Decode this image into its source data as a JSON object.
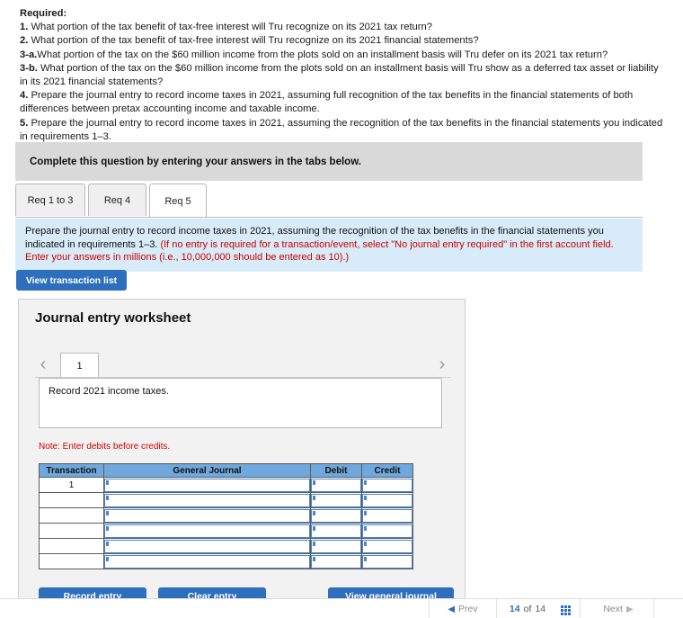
{
  "required": {
    "title": "Required:",
    "items": [
      {
        "num": "1.",
        "text": " What portion of the tax benefit of tax-free interest will Tru recognize on its 2021 tax return?"
      },
      {
        "num": "2.",
        "text": " What portion of the tax benefit of tax-free interest will Tru recognize on its 2021 financial statements?"
      },
      {
        "num": "3-a.",
        "text": "What portion of the tax on the $60 million income from the plots sold on an installment basis will Tru defer on its 2021 tax return?"
      },
      {
        "num": "3-b.",
        "text": " What portion of the tax on the $60 million income from the plots sold on an installment basis will Tru show as a deferred tax asset or liability in its 2021 financial statements?"
      },
      {
        "num": "4.",
        "text": " Prepare the journal entry to record income taxes in 2021, assuming full recognition of the tax benefits in the financial statements of both differences between pretax accounting income and taxable income."
      },
      {
        "num": "5.",
        "text": " Prepare the journal entry to record income taxes in 2021, assuming the recognition of the tax benefits in the financial statements you indicated in requirements 1–3."
      }
    ]
  },
  "banner": {
    "text": "Complete this question by entering your answers in the tabs below."
  },
  "tabs": [
    {
      "label": "Req 1 to 3",
      "active": false
    },
    {
      "label": "Req 4",
      "active": false
    },
    {
      "label": "Req 5",
      "active": true
    }
  ],
  "instruction": {
    "black": "Prepare the journal entry to record income taxes in 2021, assuming the recognition of the tax benefits in the financial statements you indicated in requirements 1–3. ",
    "red": "(If no entry is required for a transaction/event, select \"No journal entry required\" in the first account field. Enter your answers in millions (i.e., 10,000,000 should be entered as 10).)"
  },
  "view_transaction_button": {
    "label": "View transaction list"
  },
  "worksheet": {
    "title": "Journal entry worksheet",
    "prev_icon": "chevron-left-icon",
    "next_icon": "chevron-right-icon",
    "page_tab": "1",
    "description": "Record 2021 income taxes.",
    "note": "Note: Enter debits before credits.",
    "table": {
      "headers": [
        "Transaction",
        "General Journal",
        "Debit",
        "Credit"
      ],
      "rows": [
        {
          "transaction": "1",
          "general_journal": "",
          "debit": "",
          "credit": ""
        },
        {
          "transaction": "",
          "general_journal": "",
          "debit": "",
          "credit": ""
        },
        {
          "transaction": "",
          "general_journal": "",
          "debit": "",
          "credit": ""
        },
        {
          "transaction": "",
          "general_journal": "",
          "debit": "",
          "credit": ""
        },
        {
          "transaction": "",
          "general_journal": "",
          "debit": "",
          "credit": ""
        },
        {
          "transaction": "",
          "general_journal": "",
          "debit": "",
          "credit": ""
        }
      ]
    },
    "actions": [
      {
        "label": "Record entry"
      },
      {
        "label": "Clear entry"
      },
      {
        "label": "View general journal"
      }
    ]
  },
  "navbar": {
    "prev_label": "Prev",
    "next_label": "Next",
    "current_page": "14",
    "of_label": "of",
    "total_pages": "14",
    "grid_icon": "grid-icon"
  },
  "colors": {
    "accent_blue": "#2e6fbd",
    "table_header_blue": "#6fa8dc",
    "instruction_bg": "#d7ecf8",
    "banner_grey": "#d9d9d9",
    "red_text": "#cc0000"
  }
}
